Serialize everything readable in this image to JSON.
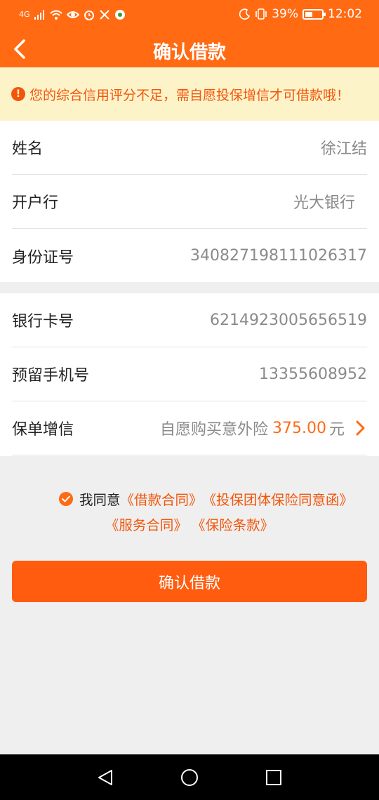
{
  "status_bar": {
    "network": "4G",
    "battery_percent": "39%",
    "time": "12:02"
  },
  "header": {
    "title": "确认借款"
  },
  "notice": {
    "text": "您的综合信用评分不足，需自愿投保增信才可借款哦！"
  },
  "info_section": {
    "rows": [
      {
        "label": "姓名",
        "value": "徐江结"
      },
      {
        "label": "开户行",
        "value": "光大银行"
      },
      {
        "label": "身份证号",
        "value": "340827198111026317"
      }
    ]
  },
  "bank_section": {
    "rows": [
      {
        "label": "银行卡号",
        "value": "6214923005656519"
      },
      {
        "label": "预留手机号",
        "value": "13355608952"
      }
    ],
    "insurance": {
      "label": "保单增信",
      "desc": "自愿购买意外险",
      "amount": "375.00",
      "unit": "元"
    }
  },
  "agreement": {
    "prefix": "我同意",
    "links": [
      "《借款合同》",
      "《投保团体保险同意函》",
      "《服务合同》",
      "《保险条款》"
    ]
  },
  "confirm_button": {
    "label": "确认借款"
  },
  "colors": {
    "brand": "#ff6a13",
    "notice_bg": "#fdf3c9",
    "notice_text": "#f2560b"
  }
}
